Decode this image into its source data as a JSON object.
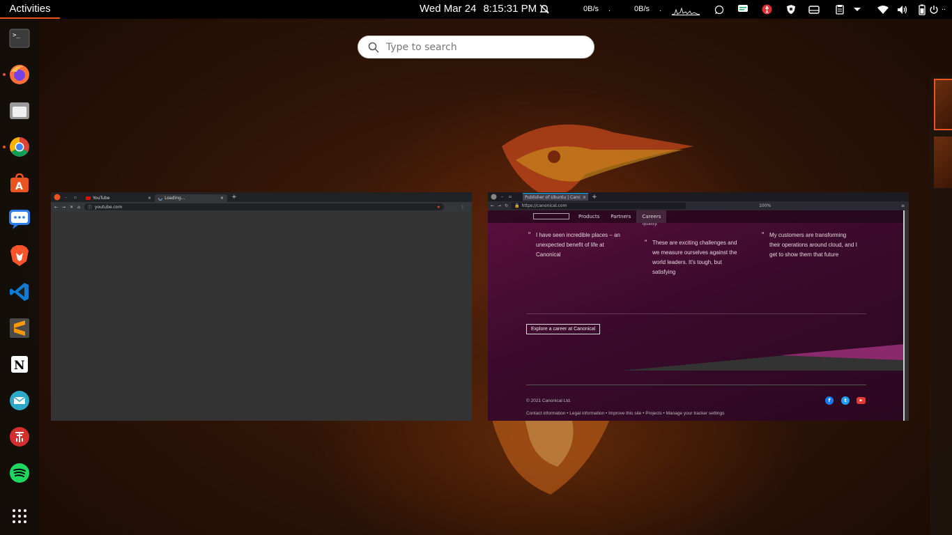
{
  "topbar": {
    "activities": "Activities",
    "date": "Wed Mar 24",
    "time": "8:15:31 PM",
    "net_down": "0B/s",
    "net_up": "0B/s",
    "net_dot1": ".",
    "net_dot2": ".",
    "tray_end": ".."
  },
  "search": {
    "placeholder": "Type to search"
  },
  "dock": {
    "items": [
      {
        "name": "terminal",
        "running": false
      },
      {
        "name": "firefox",
        "running": true
      },
      {
        "name": "files",
        "running": false
      },
      {
        "name": "chrome",
        "running": true
      },
      {
        "name": "software-center",
        "running": false
      },
      {
        "name": "chat",
        "running": false
      },
      {
        "name": "brave",
        "running": false
      },
      {
        "name": "vscode",
        "running": false
      },
      {
        "name": "sublime-text",
        "running": false
      },
      {
        "name": "notion",
        "running": false
      },
      {
        "name": "mail",
        "running": false
      },
      {
        "name": "app-red",
        "running": false
      },
      {
        "name": "spotify",
        "running": false
      },
      {
        "name": "show-apps",
        "running": false
      }
    ]
  },
  "chrome_window": {
    "tabs": [
      {
        "label": "YouTube",
        "close": "×"
      },
      {
        "label": "Loading...",
        "close": "×"
      }
    ],
    "new_tab": "+",
    "url": "youtube.com"
  },
  "firefox_window": {
    "tab_label": "Publisher of Ubuntu | Canc",
    "tab_close": "×",
    "new_tab": "+",
    "url": "https://canonical.com",
    "zoom": "100%",
    "nav": [
      "Products",
      "Partners",
      "Careers"
    ],
    "partial_text": "quality.",
    "quotes": [
      "I have seen incredible places – an unexpected benefit of life at Canonical",
      "These are exciting challenges and we measure ourselves against the world leaders. It's tough, but satisfying",
      "My customers are transforming their operations around cloud, and I get to show them that future"
    ],
    "quote_open": "“",
    "quote_close": "”",
    "career_button": "Explore a career at Canonical",
    "copyright": "© 2021 Canonical Ltd.",
    "footer_links": "Contact information  •  Legal information  •  Improve this site  •  Projects  •  Manage your tracker settings",
    "social": [
      "f",
      "t",
      "▶"
    ]
  },
  "colors": {
    "accent": "#e95420",
    "canonical_purple": "#5a0f3e",
    "panel": "#000000"
  }
}
